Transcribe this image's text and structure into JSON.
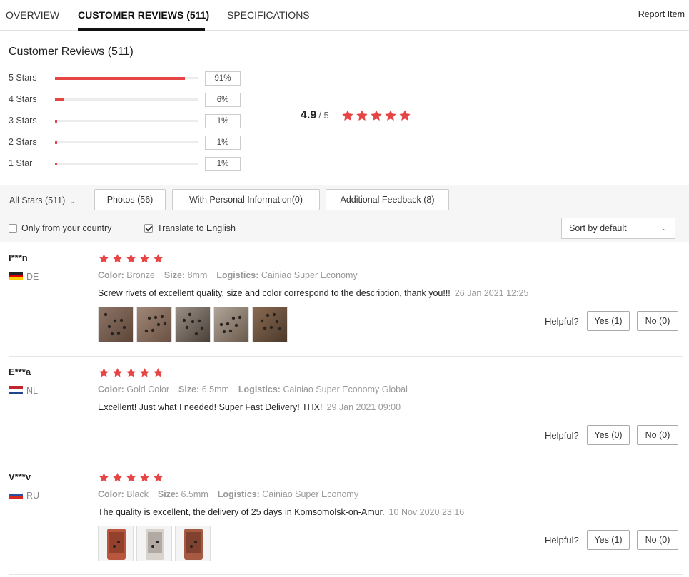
{
  "tabs": [
    {
      "label": "OVERVIEW"
    },
    {
      "label": "CUSTOMER REVIEWS (511)"
    },
    {
      "label": "SPECIFICATIONS"
    }
  ],
  "report_label": "Report Item",
  "summary": {
    "title": "Customer Reviews (511)",
    "distribution": [
      {
        "label": "5 Stars",
        "percent": 91,
        "percent_text": "91%"
      },
      {
        "label": "4 Stars",
        "percent": 6,
        "percent_text": "6%"
      },
      {
        "label": "3 Stars",
        "percent": 1,
        "percent_text": "1%"
      },
      {
        "label": "2 Stars",
        "percent": 1,
        "percent_text": "1%"
      },
      {
        "label": "1 Star",
        "percent": 1,
        "percent_text": "1%"
      }
    ],
    "average": "4.9",
    "out_of": "/ 5",
    "average_stars": 5
  },
  "colors": {
    "star": "#e64545",
    "bar_fill": "#e64545"
  },
  "filters": {
    "all_stars": "All Stars (511)",
    "buttons": [
      {
        "label": "Photos (56)"
      },
      {
        "label": "With Personal Information(0)"
      },
      {
        "label": "Additional Feedback (8)"
      }
    ],
    "only_country": {
      "label": "Only from your country",
      "checked": false
    },
    "translate": {
      "label": "Translate to English",
      "checked": true
    },
    "sort": "Sort by default"
  },
  "helpful_label": "Helpful?",
  "reviews": [
    {
      "name": "I***n",
      "country": "DE",
      "stars": 5,
      "color_label": "Color:",
      "color": "Bronze",
      "size_label": "Size:",
      "size": "8mm",
      "logistics_label": "Logistics:",
      "logistics": "Cainiao Super Economy",
      "text": "Screw rivets of excellent quality, size and color correspond to the description, thank you!!!",
      "date": "26 Jan 2021 12:25",
      "photo_count": 5,
      "yes": "Yes (1)",
      "no": "No (0)"
    },
    {
      "name": "E***a",
      "country": "NL",
      "stars": 5,
      "color_label": "Color:",
      "color": "Gold Color",
      "size_label": "Size:",
      "size": "6.5mm",
      "logistics_label": "Logistics:",
      "logistics": "Cainiao Super Economy Global",
      "text": "Excellent! Just what I needed! Super Fast Delivery! THX!",
      "date": "29 Jan 2021 09:00",
      "photo_count": 0,
      "yes": "Yes (0)",
      "no": "No (0)"
    },
    {
      "name": "V***v",
      "country": "RU",
      "stars": 5,
      "color_label": "Color:",
      "color": "Black",
      "size_label": "Size:",
      "size": "6.5mm",
      "logistics_label": "Logistics:",
      "logistics": "Cainiao Super Economy",
      "text": "The quality is excellent, the delivery of 25 days in Komsomolsk-on-Amur.",
      "date": "10 Nov 2020 23:16",
      "photo_count": 3,
      "yes": "Yes (1)",
      "no": "No (0)"
    }
  ]
}
